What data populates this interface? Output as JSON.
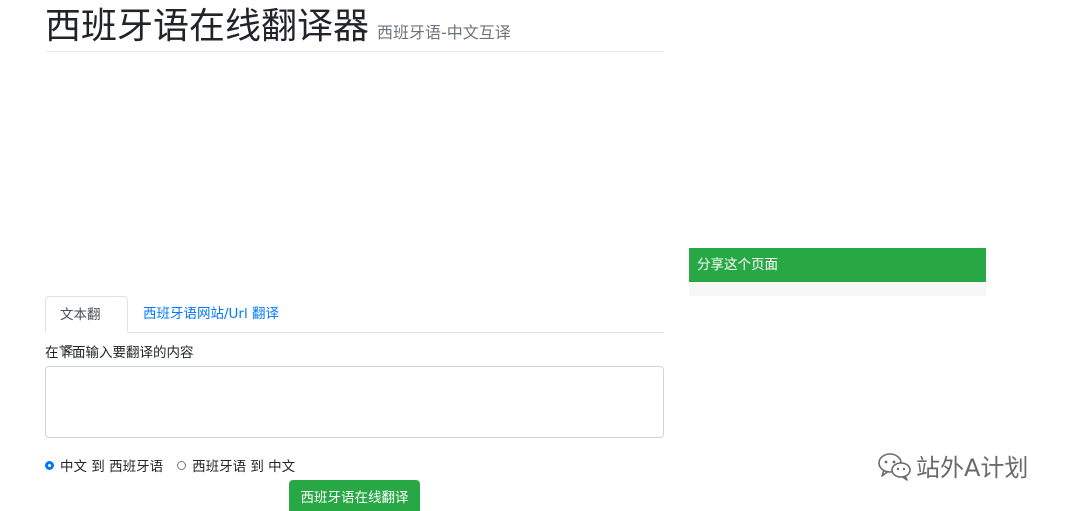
{
  "header": {
    "title": "西班牙语在线翻译器",
    "subtitle": "西班牙语-中文互译"
  },
  "tabs": [
    {
      "label": "文本翻译",
      "active": true
    },
    {
      "label": "西班牙语网站/Url 翻译",
      "active": false
    }
  ],
  "form": {
    "input_label": "在下面输入要翻译的内容",
    "textarea_value": "",
    "textarea_placeholder": "",
    "radio_options": [
      {
        "label": "中文 到 西班牙语",
        "checked": true
      },
      {
        "label": "西班牙语 到 中文",
        "checked": false
      }
    ],
    "submit_label": "西班牙语在线翻译"
  },
  "share": {
    "title": "分享这个页面"
  },
  "watermark": {
    "text": "站外A计划",
    "icon": "wechat-icon"
  },
  "colors": {
    "accent_green": "#28a745",
    "link_blue": "#007bff",
    "radio_blue": "#0075ff"
  }
}
